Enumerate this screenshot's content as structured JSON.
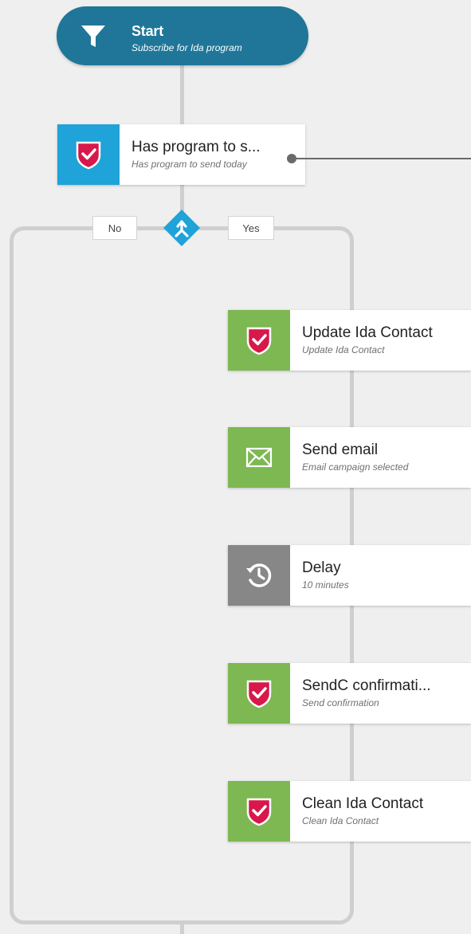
{
  "colors": {
    "start": "#1f7698",
    "condition_tile": "#1fa3d8",
    "action_tile": "#7db853",
    "delay_tile": "#878787",
    "shield": "#d8174a",
    "wire": "#cfcfcf"
  },
  "start": {
    "title": "Start",
    "subtitle": "Subscribe for Ida program",
    "icon": "funnel-icon"
  },
  "condition": {
    "title": "Has program to s...",
    "subtitle": "Has program to send today",
    "icon": "shield-check-icon"
  },
  "branches": {
    "no_label": "No",
    "yes_label": "Yes",
    "icon": "split-arrows-icon"
  },
  "nodes": [
    {
      "title": "Update Ida Contact",
      "subtitle": "Update Ida Contact",
      "icon": "shield-check-icon"
    },
    {
      "title": "Send email",
      "subtitle": "Email campaign selected",
      "icon": "envelope-icon"
    },
    {
      "title": "Delay",
      "subtitle": "10 minutes",
      "icon": "clock-history-icon"
    },
    {
      "title": "SendC confirmati...",
      "subtitle": "Send confirmation",
      "icon": "shield-check-icon"
    },
    {
      "title": "Clean Ida Contact",
      "subtitle": "Clean Ida Contact",
      "icon": "shield-check-icon"
    }
  ]
}
